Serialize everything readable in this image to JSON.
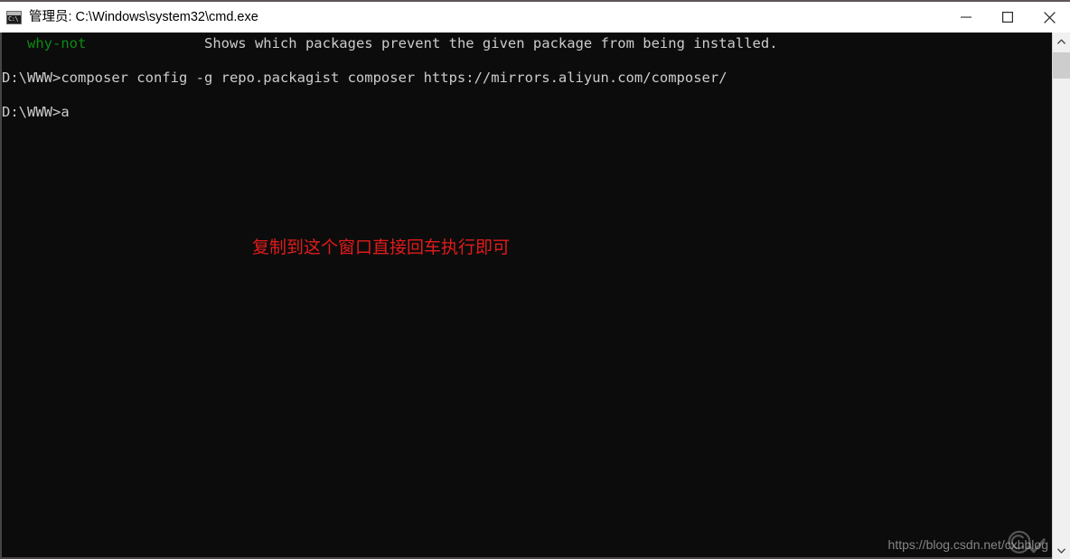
{
  "window": {
    "title": "管理员: C:\\Windows\\system32\\cmd.exe",
    "icon_name": "cmd-console-icon",
    "icon_glyph": "C:\\",
    "background_color": "#0c0c0c",
    "titlebar_color": "#ffffff"
  },
  "window_controls": {
    "minimize_label": "最小化",
    "maximize_label": "最大化",
    "close_label": "关闭"
  },
  "terminal": {
    "lines": [
      {
        "id": "help-why-not",
        "command": "why-not",
        "description": "Shows which packages prevent the given package from being installed.",
        "command_color": "#0d8a12",
        "text_color": "#cccccc"
      },
      {
        "id": "composer-config-command",
        "text": "D:\\WWW>composer config -g repo.packagist composer https://mirrors.aliyun.com/composer/"
      },
      {
        "id": "current-prompt",
        "text": "D:\\WWW>a"
      }
    ]
  },
  "annotation": {
    "text": "复制到这个窗口直接回车执行即可",
    "color": "#e01b1b"
  },
  "watermark": {
    "text": "https://blog.csdn.net/cxhblog"
  },
  "scrollbar": {
    "up_arrow_name": "scroll-up-arrow",
    "down_arrow_name": "scroll-down-arrow",
    "thumb_name": "scroll-thumb"
  }
}
